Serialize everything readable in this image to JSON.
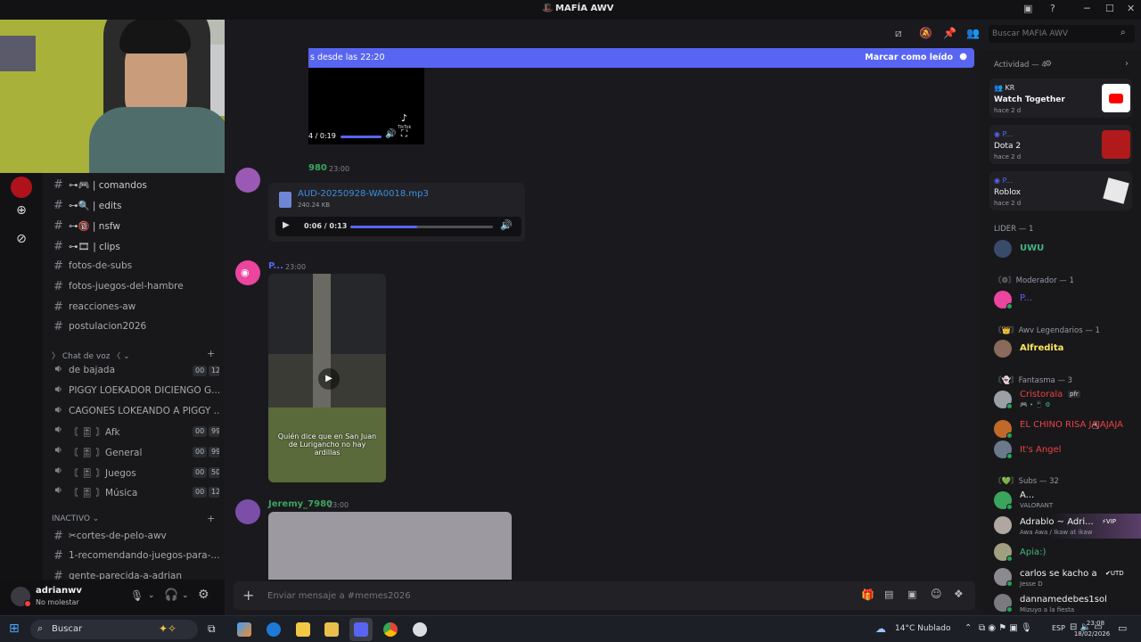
{
  "window": {
    "title": "MAFÍA AWV"
  },
  "banner": {
    "text": "s desde las 22:20",
    "mark_read": "Marcar como leído"
  },
  "channels": {
    "text": [
      {
        "icon": "⊶🎮",
        "label": "| comandos"
      },
      {
        "icon": "⊶🔍",
        "label": "| edits"
      },
      {
        "icon": "⊶🔞",
        "label": "| nsfw"
      },
      {
        "icon": "⊶🎞",
        "label": "| clips"
      },
      {
        "label": "fotos-de-subs"
      },
      {
        "label": "fotos-juegos-del-hambre"
      },
      {
        "label": "reacciones-aw"
      },
      {
        "label": "postulacion2026"
      }
    ],
    "voice_category": "Chat de voz 〈 ⌄",
    "voice": [
      {
        "label": "de bajada",
        "a": "00",
        "b": "12"
      },
      {
        "label": "PIGGY LOEKADOR DICIENGO G..."
      },
      {
        "label": "CAGONES LOKEANDO A PIGGY ..."
      },
      {
        "label": "〘 🎚 〙Afk",
        "a": "00",
        "b": "99"
      },
      {
        "label": "〘 🎚 〙General",
        "a": "00",
        "b": "99"
      },
      {
        "label": "〘 🎚 〙Juegos",
        "a": "00",
        "b": "50"
      },
      {
        "label": "〘 🎚 〙Música",
        "a": "00",
        "b": "12"
      }
    ],
    "inactive_category": "INACTIVO ⌄",
    "inactive": [
      {
        "label": "✂cortes-de-pelo-awv"
      },
      {
        "label": "1-recomendando-juegos-para-..."
      },
      {
        "label": "gente-parecida-a-adrian"
      }
    ]
  },
  "user": {
    "name": "adrianwv",
    "status": "No molestar"
  },
  "messages": {
    "video1": {
      "time": "4 / 0:19",
      "brand": "TikTok"
    },
    "msg1": {
      "name": "980",
      "time": "23:00",
      "file": "AUD-20250928-WA0018.mp3",
      "size": "240.24 KB",
      "audio_time": "0:06 / 0:13",
      "progress": 0.47
    },
    "msg2": {
      "name": "P...",
      "time": "23:00",
      "caption": "Quién dice que en San Juan de Lurigancho no hay ardillas"
    },
    "msg3": {
      "name": "Jeremy_7980",
      "time": "23:00"
    }
  },
  "composer": {
    "placeholder": "Enviar mensaje a #memes2026"
  },
  "search": {
    "placeholder": "Buscar MAFÍA AWV"
  },
  "members": {
    "activity_header": "Actividad — 4",
    "activities": [
      {
        "user": "KR",
        "title": "Watch Together",
        "ago": "hace 2 d"
      },
      {
        "user": "P...",
        "title": "Dota 2",
        "ago": "hace 2 d"
      },
      {
        "user": "P...",
        "title": "Roblox",
        "ago": "hace 2 d"
      }
    ],
    "sections": {
      "lider": "LIDER — 1",
      "moderador": "〘⚙〙Moderador — 1",
      "legendarios": "〘👑〙Awv Legendarios — 1",
      "fantasma": "〘👻〙Fantasma — 3",
      "subs": "〘💚〙Subs — 32"
    },
    "list": {
      "uwu": "UWU",
      "mod": "P...",
      "alfredita": "Alfredita",
      "cristorala": "Cristorala",
      "cristorala_tag": "pfr",
      "chino": "EL CHINO RISA JAJAJAJA",
      "angel": "It's Angel",
      "a": "A...",
      "a_sub": "VALORANT",
      "adrablo": "Adrablo ~ Adri...",
      "adrablo_tag": "VIP",
      "adrablo_sub": "Awa Awa / Ikaw at ikaw",
      "apia": "Apia:)",
      "carlos": "carlos se kacho a ...",
      "carlos_tag": "UTD",
      "carlos_sub": "Jesse D",
      "dann": "dannamedebes1sol",
      "dann_sub": "Mizuyo a la fiesta"
    }
  },
  "taskbar": {
    "search": "Buscar",
    "weather": "14°C  Nublado",
    "lang": "ESP",
    "time": "23:08",
    "date": "18/02/2026"
  }
}
